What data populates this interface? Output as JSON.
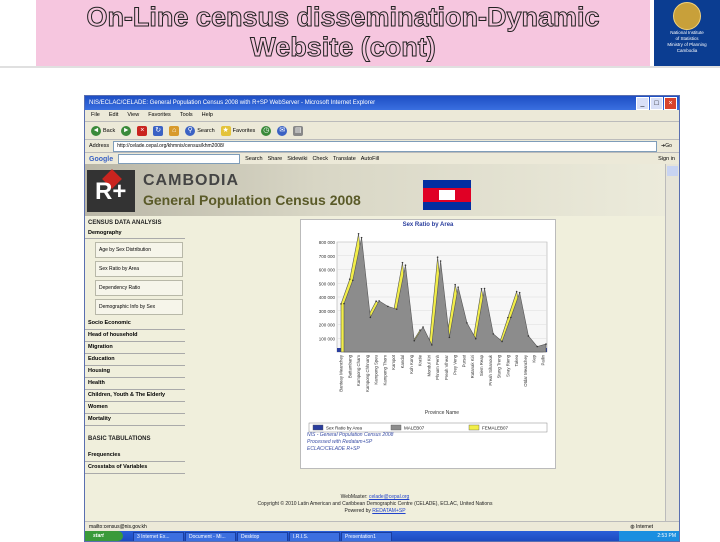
{
  "slide": {
    "title_line1": "On-Line census dissemination-Dynamic",
    "title_line2": "Website (cont)",
    "logo_lines": [
      "National Institute",
      "of Statistics",
      "Ministry of Planning",
      "Cambodia"
    ]
  },
  "browser": {
    "window_title": "NIS/ECLAC/CELADE: General Population Census 2008 with R+SP WebServer - Microsoft Internet Explorer",
    "menu": [
      "File",
      "Edit",
      "View",
      "Favorites",
      "Tools",
      "Help"
    ],
    "toolbar": {
      "back": "Back",
      "search": "Search",
      "favorites": "Favorites"
    },
    "address_label": "Address",
    "address_value": "http://celade.cepal.org/khmnis/census/khm2008/",
    "go_label": "Go",
    "google": {
      "logo": "Google",
      "search_label": "Search",
      "share_label": "Share",
      "sidewiki_label": "Sidewiki",
      "check_label": "Check",
      "translate_label": "Translate",
      "autofill_label": "AutoFill",
      "signin_label": "Sign in"
    },
    "status_left": "mailto:census@nis.gov.kh",
    "status_right": "Internet"
  },
  "page": {
    "banner_country": "CAMBODIA",
    "banner_census": "General Population Census 2008",
    "sidebar": {
      "heading": "CENSUS DATA ANALYSIS",
      "demography_label": "Demography",
      "buttons": [
        "Age by Sex Distribution",
        "Sex Ratio by Area",
        "Dependency Ratio",
        "Demographic Info by Sex"
      ],
      "links": [
        "Socio Economic",
        "Head of household",
        "Migration",
        "Education",
        "Housing",
        "Health",
        "Children, Youth & The Elderly",
        "Women",
        "Mortality"
      ],
      "basic_heading": "BASIC TABULATIONS",
      "basic_links": [
        "Frequencies",
        "Crosstabs of Variables"
      ]
    },
    "notes": [
      "NIS - General Population Census 2008",
      "Processed with Redatam+SP",
      "ECLAC/CELADE R+SP"
    ],
    "footer": {
      "webmaster_label": "WebMaster:",
      "webmaster_email": "celade@cepal.org",
      "copyright": "Copyright © 2010 Latin American and Caribbean Demographic Centre (CELADE), ECLAC, United Nations",
      "powered_label": "Powered by",
      "powered_link": "REDATAM+SP"
    }
  },
  "taskbar": {
    "start": "start",
    "items": [
      "3 Internet Ex...",
      "Document - Mi...",
      "Desktop",
      "I.R.I.S.",
      "Presentation1"
    ],
    "clock": "2:53 PM"
  },
  "colors": {
    "title_fill": "#f4c4dc",
    "chart_title": "#2a3e9e",
    "series_yellow": "#f2ee48",
    "series_gray": "#8c8c8c"
  },
  "chart_data": {
    "type": "area",
    "title": "Sex Ratio by Area",
    "xlabel": "Province Name",
    "ylabel": "",
    "ylim": [
      0,
      800000
    ],
    "yticks": [
      "800 000",
      "700 000",
      "600 000",
      "500 000",
      "400 000",
      "300 000",
      "200 000",
      "100 000"
    ],
    "categories": [
      "Banteay Meanchey",
      "Battambang",
      "Kampong Cham",
      "Kampong Chhnang",
      "Kampong Speu",
      "Kampong Thom",
      "Kampot",
      "Kandal",
      "Koh Kong",
      "Kratie",
      "Mondul Kiri",
      "Phnom Penh",
      "Preah Vihear",
      "Prey Veng",
      "Pursat",
      "Ratanak Kiri",
      "Siem Reap",
      "Preah Sihanouk",
      "Stung Treng",
      "Svay Rieng",
      "Takeo",
      "Otdar Meanchey",
      "Kep",
      "Pailin"
    ],
    "series": [
      {
        "name": "Sex Ratio by Area",
        "values": [
          95,
          96,
          94,
          93,
          94,
          95,
          95,
          94,
          103,
          98,
          102,
          93,
          100,
          92,
          95,
          101,
          96,
          99,
          99,
          93,
          93,
          102,
          97,
          104
        ]
      },
      {
        "name": "MALEB07",
        "values": [
          330000,
          500000,
          810000,
          230000,
          350000,
          310000,
          290000,
          610000,
          60000,
          160000,
          30000,
          640000,
          85000,
          450000,
          190000,
          75000,
          440000,
          110000,
          55000,
          230000,
          410000,
          95000,
          18000,
          36000
        ]
      },
      {
        "name": "FEMALEB07",
        "values": [
          350000,
          530000,
          860000,
          250000,
          370000,
          320000,
          300000,
          650000,
          57000,
          160000,
          30000,
          690000,
          85000,
          490000,
          205000,
          75000,
          460000,
          111000,
          56000,
          250000,
          440000,
          90000,
          18000,
          34000
        ]
      }
    ],
    "legend_position": "bottom"
  }
}
